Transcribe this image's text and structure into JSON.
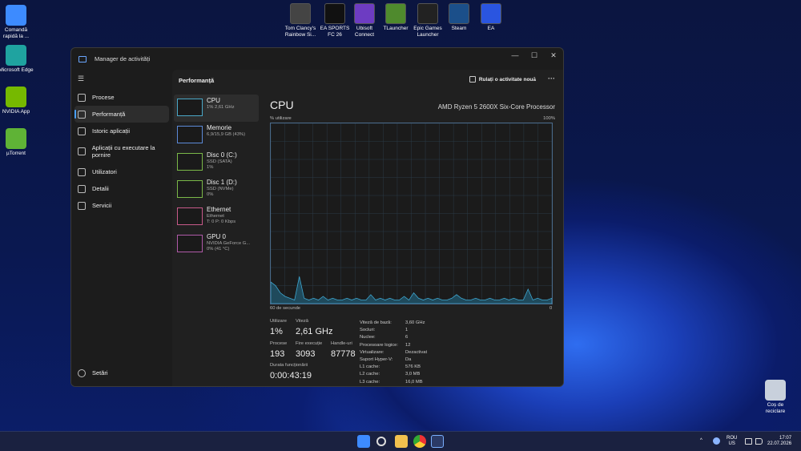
{
  "desktop_left": [
    {
      "label": "Comandă rapidă la ...",
      "color": "#3d8bff"
    },
    {
      "label": "Microsoft Edge",
      "color": "#1fa3a0"
    },
    {
      "label": "NVIDIA App",
      "color": "#76b900"
    },
    {
      "label": "µTorrent",
      "color": "#5fb336"
    }
  ],
  "desktop_top": [
    {
      "label": "Tom Clancy's Rainbow Si...",
      "color": "#444"
    },
    {
      "label": "EA SPORTS FC 26",
      "color": "#111"
    },
    {
      "label": "Ubisoft Connect",
      "color": "#6d3cc2"
    },
    {
      "label": "TLauncher",
      "color": "#4f8a2d"
    },
    {
      "label": "Epic Games Launcher",
      "color": "#222"
    },
    {
      "label": "Steam",
      "color": "#1b4f8a"
    },
    {
      "label": "EA",
      "color": "#2a55e0"
    }
  ],
  "recycle_bin": "Coș de reciclare",
  "window": {
    "title": "Manager de activități",
    "caption_min": "—",
    "caption_max": "☐",
    "caption_close": "✕",
    "hamburger": "☰"
  },
  "nav": {
    "items": [
      "Procese",
      "Performanță",
      "Istoric aplicații",
      "Aplicații cu executare la pornire",
      "Utilizatori",
      "Detalii",
      "Servicii"
    ],
    "settings": "Setări"
  },
  "header": {
    "title": "Performanță",
    "run_task": "Rulați o activitate nouă",
    "more": "···"
  },
  "devices": [
    {
      "name": "CPU",
      "sub1": "1% 2,61 GHz",
      "sub2": "",
      "color": "#4aa8c8"
    },
    {
      "name": "Memorie",
      "sub1": "6,9/15,9 GB (43%)",
      "sub2": "",
      "color": "#5c8ad8"
    },
    {
      "name": "Disc 0 (C:)",
      "sub1": "SSD (SATA)",
      "sub2": "1%",
      "color": "#7ab848"
    },
    {
      "name": "Disc 1 (D:)",
      "sub1": "SSD (NVMe)",
      "sub2": "0%",
      "color": "#7ab848"
    },
    {
      "name": "Ethernet",
      "sub1": "Ethernet",
      "sub2": "T: 0 P: 0 Kbps",
      "color": "#c85a8a"
    },
    {
      "name": "GPU 0",
      "sub1": "NVIDIA GeForce G...",
      "sub2": "0% (41 °C)",
      "color": "#b05aa8"
    }
  ],
  "cpu": {
    "title": "CPU",
    "model": "AMD Ryzen 5 2600X Six-Core Processor",
    "util_label": "% utilizare",
    "pct_max": "100%",
    "time_label": "60 de secunde",
    "time_zero": "0",
    "utilizare_label": "Utilizare",
    "utilizare": "1%",
    "viteza_label": "Viteză",
    "viteza": "2,61 GHz",
    "procese_label": "Procese",
    "procese": "193",
    "fire_label": "Fire execuție",
    "fire": "3093",
    "handle_label": "Handle-uri",
    "handle": "87778",
    "durata_label": "Durata funcționării",
    "durata": "0:00:43:19",
    "specs": [
      {
        "k": "Viteză de bază:",
        "v": "3,60 GHz"
      },
      {
        "k": "Socluri:",
        "v": "1"
      },
      {
        "k": "Nuclee:",
        "v": "6"
      },
      {
        "k": "Procesoare logice:",
        "v": "12"
      },
      {
        "k": "Virtualizare:",
        "v": "Dezactivat"
      },
      {
        "k": "Suport Hyper-V:",
        "v": "Da"
      },
      {
        "k": "L1 cache:",
        "v": "576 KB"
      },
      {
        "k": "L2 cache:",
        "v": "3,0 MB"
      },
      {
        "k": "L3 cache:",
        "v": "16,0 MB"
      }
    ],
    "graph_values": [
      12,
      10,
      6,
      4,
      3,
      2,
      15,
      3,
      2,
      3,
      2,
      4,
      2,
      3,
      2,
      2,
      3,
      2,
      3,
      2,
      2,
      5,
      2,
      3,
      2,
      3,
      2,
      2,
      4,
      2,
      6,
      3,
      2,
      3,
      2,
      3,
      2,
      2,
      3,
      5,
      3,
      2,
      2,
      3,
      2,
      2,
      3,
      2,
      2,
      3,
      2,
      3,
      2,
      2,
      8,
      2,
      3,
      2,
      2,
      3
    ]
  },
  "taskbar": {
    "lang1": "ROU",
    "lang2": "US",
    "time": "17:07",
    "date": "22.07.2026",
    "chevron": "^"
  }
}
